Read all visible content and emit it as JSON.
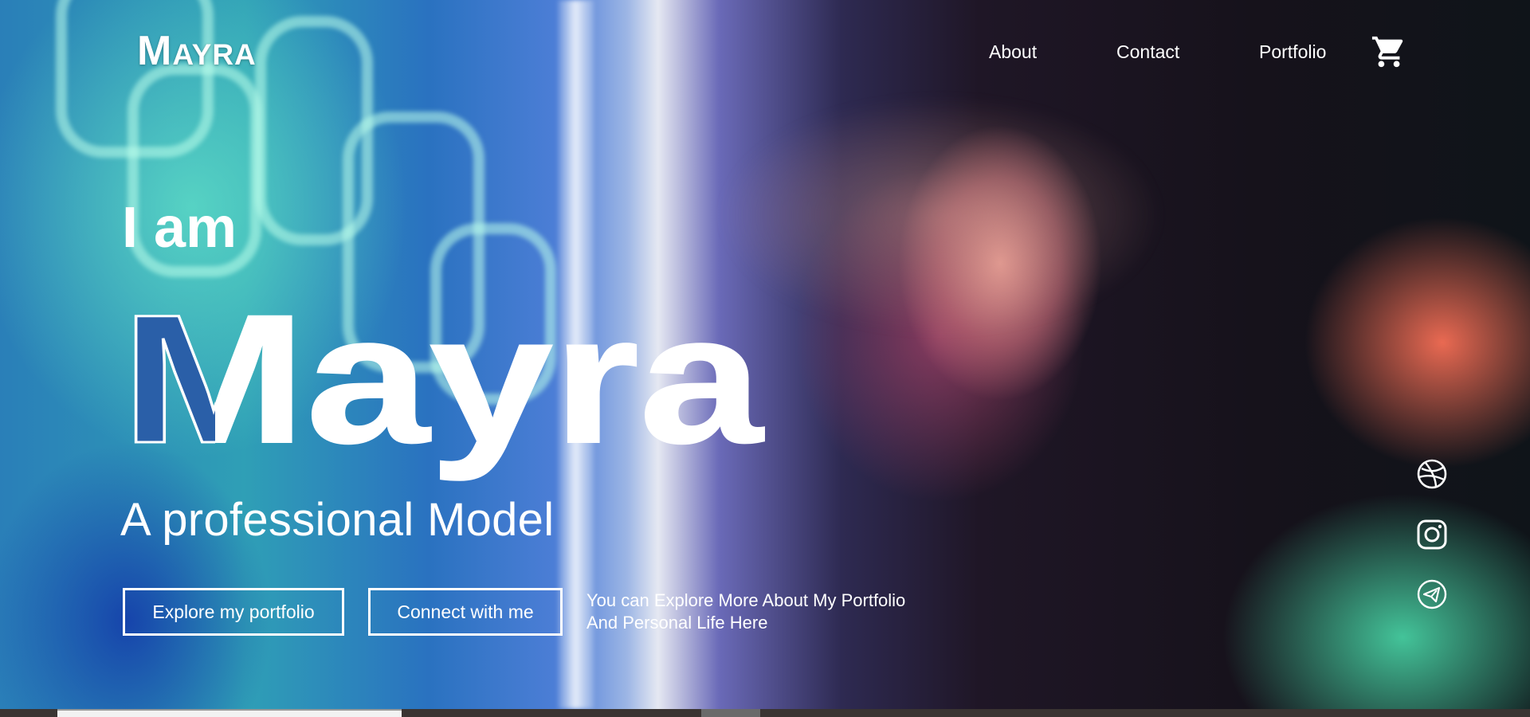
{
  "logo": {
    "first": "M",
    "rest": "AYRA"
  },
  "nav": {
    "links": [
      {
        "label": "About"
      },
      {
        "label": "Contact"
      },
      {
        "label": "Portfolio"
      }
    ],
    "cart_icon": "shopping-cart-icon"
  },
  "hero": {
    "intro": "I am",
    "name": "Mayra",
    "tagline": "A professional Model",
    "buttons": {
      "portfolio": "Explore my portfolio",
      "connect": "Connect with me"
    },
    "note_line1": "You can Explore More About My Portfolio",
    "note_line2": "And Personal Life Here"
  },
  "social": {
    "icons": [
      "dribbble-icon",
      "instagram-icon",
      "telegram-icon"
    ]
  },
  "colors": {
    "text": "#ffffff",
    "background_dark": "#0f1419",
    "neon_blue": "#2a72c0",
    "neon_teal": "#46cda0",
    "neon_orange": "#f56e55"
  }
}
